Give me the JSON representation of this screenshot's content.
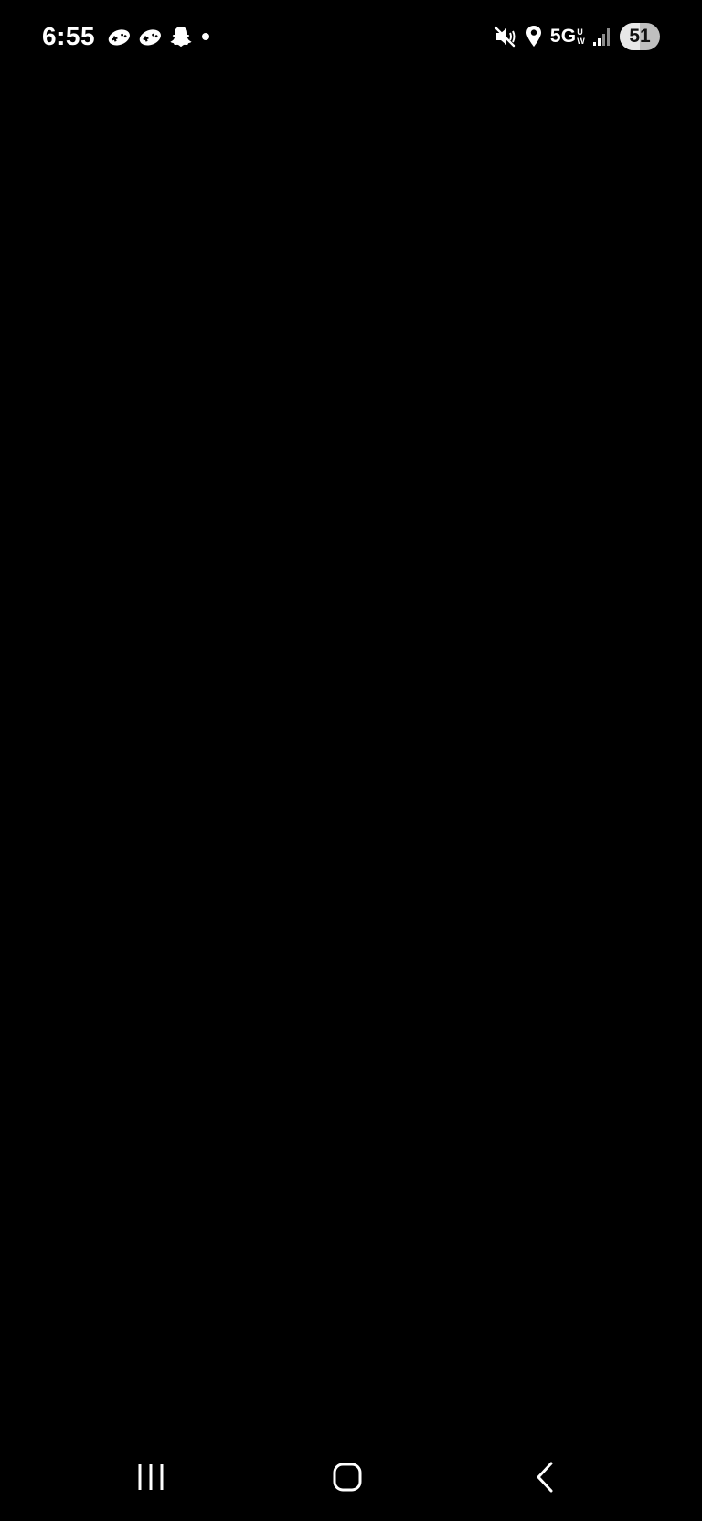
{
  "status_bar": {
    "time": "6:55",
    "notification_icons": [
      "game-controller-icon",
      "game-controller-icon",
      "snapchat-ghost-icon",
      "more-notifications-dot-icon"
    ],
    "network": "5G",
    "network_suffix_top": "U",
    "network_suffix_bottom": "W",
    "battery_level": "51",
    "battery_fraction": 0.51,
    "system_icons": [
      "mute-vibrate-icon",
      "location-pin-icon",
      "signal-strength-icon",
      "battery-icon"
    ]
  },
  "screen": {
    "background": "#000000"
  },
  "navigation_bar": {
    "buttons": [
      "recent-apps",
      "home",
      "back"
    ]
  }
}
